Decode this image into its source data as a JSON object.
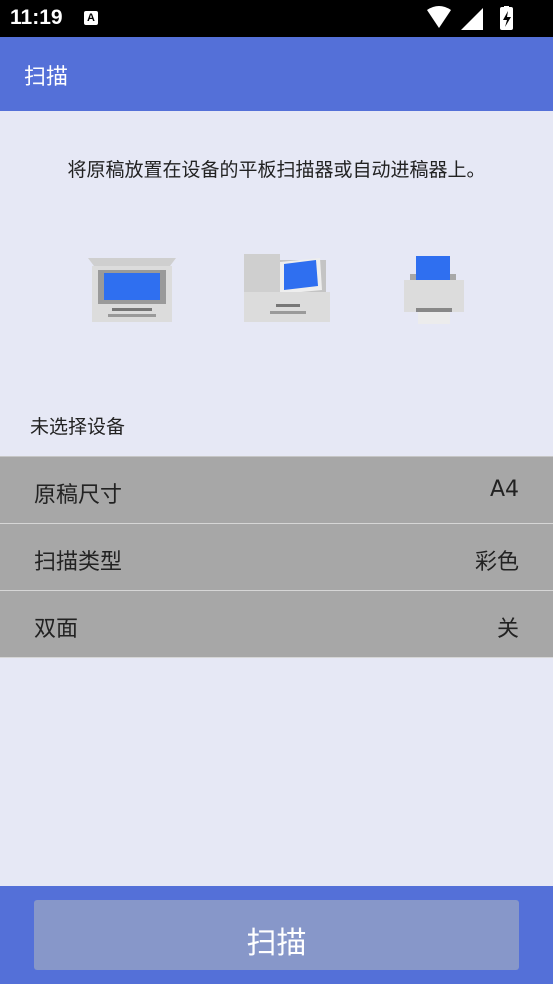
{
  "status_bar": {
    "time": "11:19",
    "notification_icon": "a-icon"
  },
  "app_bar": {
    "title": "扫描"
  },
  "instruction": "将原稿放置在设备的平板扫描器或自动进稿器上。",
  "devices": [
    {
      "icon": "flatbed-scanner-icon"
    },
    {
      "icon": "adf-scanner-icon"
    },
    {
      "icon": "printer-icon"
    }
  ],
  "device_status": "未选择设备",
  "settings": [
    {
      "label": "原稿尺寸",
      "value": "A4"
    },
    {
      "label": "扫描类型",
      "value": "彩色"
    },
    {
      "label": "双面",
      "value": "关"
    }
  ],
  "scan_button": {
    "label": "扫描"
  },
  "colors": {
    "primary": "#5470d8",
    "background": "#e6e8f5",
    "row": "#a7a7a7",
    "button": "#8797c9"
  }
}
